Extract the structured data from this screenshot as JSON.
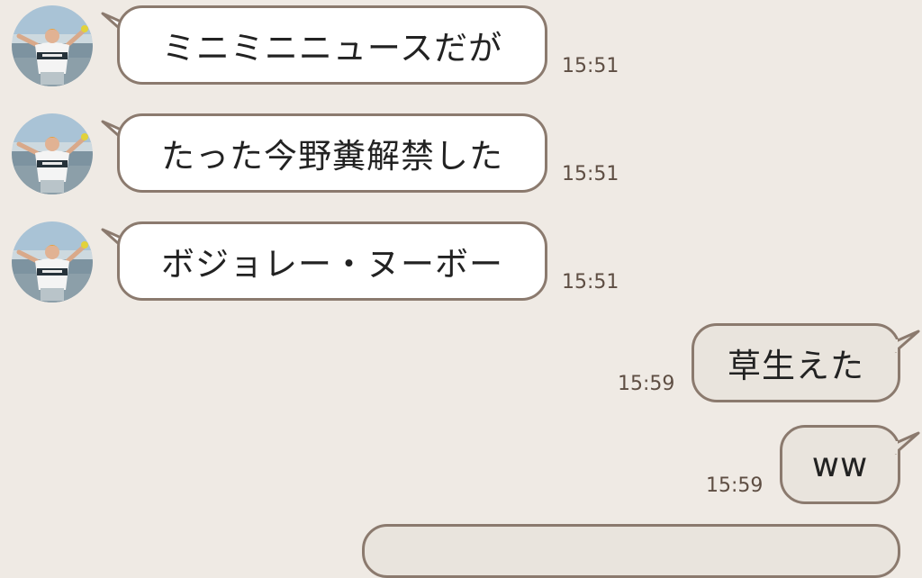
{
  "colors": {
    "background": "#efeae4",
    "incoming_bubble": "#ffffff",
    "outgoing_bubble": "#e9e4dd",
    "bubble_border": "#8b7a6e",
    "timestamp": "#5e4e43"
  },
  "messages": [
    {
      "text": "ミニミニニュースだが",
      "time": "15:51",
      "direction": "incoming",
      "avatar_icon": "user-avatar-icon"
    },
    {
      "text": "たった今野糞解禁した",
      "time": "15:51",
      "direction": "incoming",
      "avatar_icon": "user-avatar-icon"
    },
    {
      "text": "ボジョレー・ヌーボー",
      "time": "15:51",
      "direction": "incoming",
      "avatar_icon": "user-avatar-icon"
    },
    {
      "text": "草生えた",
      "time": "15:59",
      "direction": "outgoing"
    },
    {
      "text": "ww",
      "time": "15:59",
      "direction": "outgoing"
    }
  ]
}
